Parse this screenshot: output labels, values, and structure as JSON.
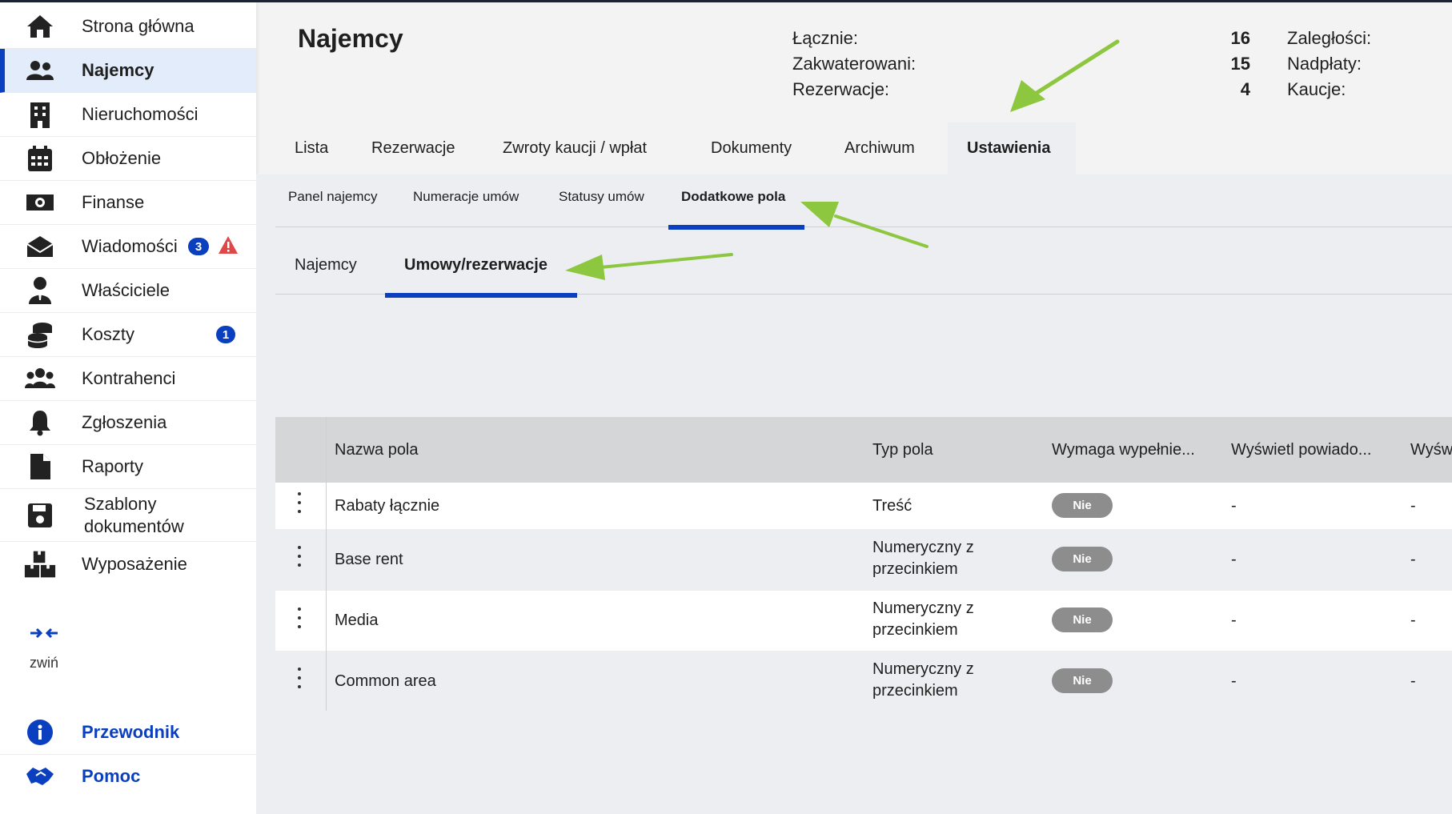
{
  "sidebar": {
    "items": [
      {
        "label": "Strona główna",
        "icon": "home-icon"
      },
      {
        "label": "Najemcy",
        "icon": "users-icon",
        "active": true
      },
      {
        "label": "Nieruchomości",
        "icon": "building-icon"
      },
      {
        "label": "Obłożenie",
        "icon": "calendar-icon"
      },
      {
        "label": "Finanse",
        "icon": "money-icon"
      },
      {
        "label": "Wiadomości",
        "icon": "envelope-icon",
        "badge": "3",
        "alert_icon": "warning-icon"
      },
      {
        "label": "Właściciele",
        "icon": "owner-icon"
      },
      {
        "label": "Koszty",
        "icon": "coins-icon",
        "badge": "1"
      },
      {
        "label": "Kontrahenci",
        "icon": "group-icon"
      },
      {
        "label": "Zgłoszenia",
        "icon": "bell-icon"
      },
      {
        "label": "Raporty",
        "icon": "file-icon"
      },
      {
        "label_line1": "Szablony",
        "label_line2": "dokumentów",
        "icon": "save-icon"
      },
      {
        "label": "Wyposażenie",
        "icon": "boxes-icon"
      }
    ],
    "collapse_label": "zwiń",
    "guide_label": "Przewodnik",
    "help_label": "Pomoc"
  },
  "header": {
    "title": "Najemcy",
    "stats": {
      "total_label": "Łącznie:",
      "total_value": "16",
      "housed_label": "Zakwaterowani:",
      "housed_value": "15",
      "reservations_label": "Rezerwacje:",
      "reservations_value": "4",
      "arrears_label": "Zaległości:",
      "overpayments_label": "Nadpłaty:",
      "deposits_label": "Kaucje:"
    }
  },
  "tabs": [
    "Lista",
    "Rezerwacje",
    "Zwroty kaucji / wpłat",
    "Dokumenty",
    "Archiwum",
    "Ustawienia"
  ],
  "subtabs": [
    "Panel najemcy",
    "Numeracje umów",
    "Statusy umów",
    "Dodatkowe pola"
  ],
  "subtabs2": [
    "Najemcy",
    "Umowy/rezerwacje"
  ],
  "table": {
    "headers": [
      "Nazwa pola",
      "Typ pola",
      "Wymaga wypełnie...",
      "Wyświetl powiado...",
      "Wyśw"
    ],
    "rows": [
      {
        "name": "Rabaty łącznie",
        "type_line1": "Treść",
        "type_line2": "",
        "required": "Nie",
        "notify": "-",
        "show": "-"
      },
      {
        "name": "Base rent",
        "type_line1": "Numeryczny z",
        "type_line2": "przecinkiem",
        "required": "Nie",
        "notify": "-",
        "show": "-"
      },
      {
        "name": "Media",
        "type_line1": "Numeryczny z",
        "type_line2": "przecinkiem",
        "required": "Nie",
        "notify": "-",
        "show": "-"
      },
      {
        "name": "Common area",
        "type_line1": "Numeryczny z",
        "type_line2": "przecinkiem",
        "required": "Nie",
        "notify": "-",
        "show": "-"
      }
    ]
  },
  "colors": {
    "accent": "#0a3fbf",
    "arrow": "#8dc63f",
    "alert": "#e04848",
    "pill": "#8d8d8d"
  }
}
